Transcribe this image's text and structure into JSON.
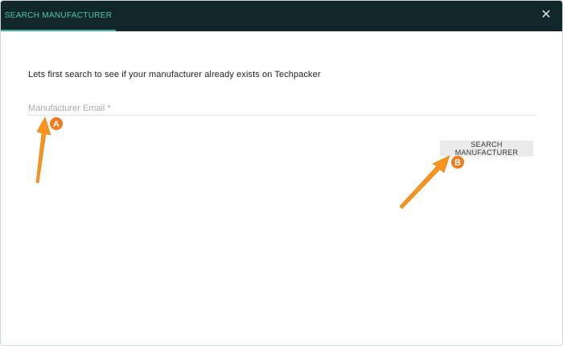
{
  "header": {
    "tab_label": "SEARCH MANUFACTURER",
    "close_glyph": "✕",
    "background_color": "#12272b",
    "accent_color": "#3bb9a0"
  },
  "main": {
    "intro_text": "Lets first search to see if your manufacturer already exists on Techpacker",
    "email_field": {
      "placeholder": "Manufacturer Email *",
      "value": ""
    },
    "search_button_label": "SEARCH MANUFACTURER"
  },
  "annotations": {
    "color": "#f7931e",
    "marker_a_label": "A",
    "marker_b_label": "B"
  },
  "icons": {
    "close": "close-icon",
    "arrow_a": "arrow-icon",
    "arrow_b": "arrow-icon"
  }
}
